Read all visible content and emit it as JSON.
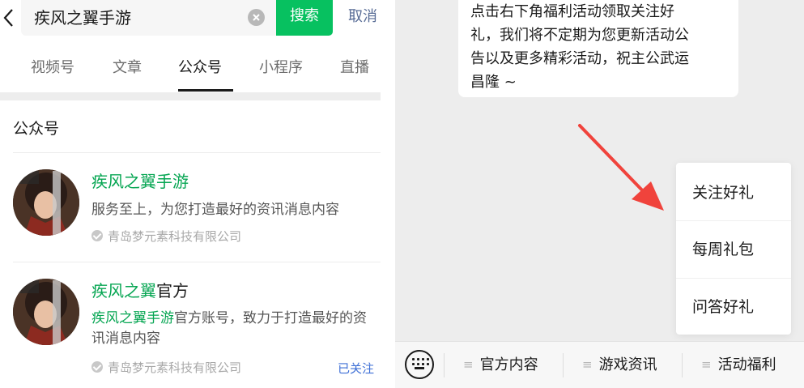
{
  "search": {
    "query": "疾风之翼手游",
    "search_button": "搜索",
    "cancel_button": "取消"
  },
  "tabs": [
    {
      "label": "视频号",
      "active": false
    },
    {
      "label": "文章",
      "active": false
    },
    {
      "label": "公众号",
      "active": true
    },
    {
      "label": "小程序",
      "active": false
    },
    {
      "label": "直播",
      "active": false
    }
  ],
  "section_title": "公众号",
  "results": [
    {
      "title_highlight": "疾风之翼手游",
      "title_rest": "",
      "desc_highlight": "",
      "desc_rest": "服务至上，为您打造最好的资讯消息内容",
      "org": "青岛梦元素科技有限公司",
      "status": ""
    },
    {
      "title_highlight": "疾风之翼",
      "title_rest": "官方",
      "desc_highlight": "疾风之翼手游",
      "desc_rest": "官方账号，致力于打造最好的资讯消息内容",
      "org": "青岛梦元素科技有限公司",
      "status": "已关注"
    }
  ],
  "chat": {
    "message_lines": [
      "点击右下角福利活动领取关注好",
      "礼，我们将不定期为您更新活动公",
      "告以及更多精彩活动，祝主公武运",
      "昌隆 ~"
    ]
  },
  "popup_menu": [
    "关注好礼",
    "每周礼包",
    "问答好礼"
  ],
  "bottom_menu": [
    "官方内容",
    "游戏资讯",
    "活动福利"
  ],
  "colors": {
    "accent_green": "#07c160",
    "highlight_green": "#07a653",
    "link_blue": "#576b95",
    "followed_blue": "#3e6fd6",
    "arrow_red": "#f0433c"
  }
}
